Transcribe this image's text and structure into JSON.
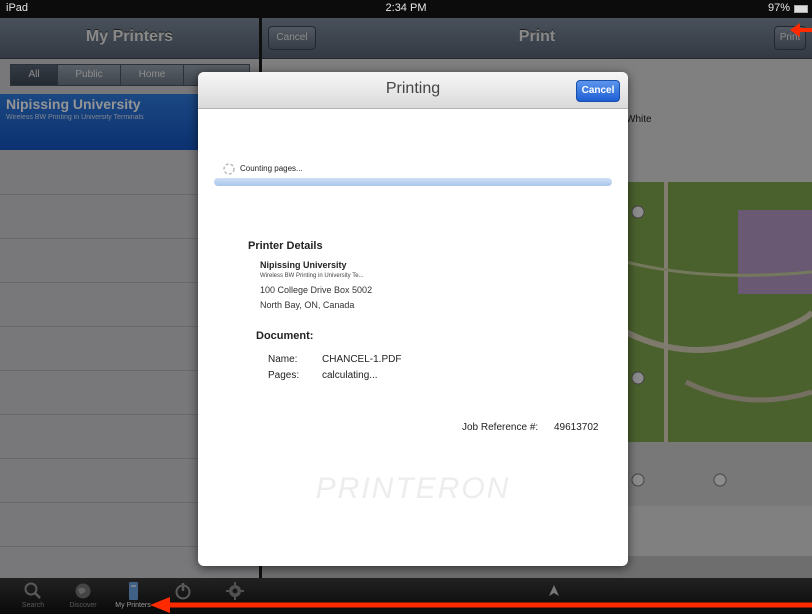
{
  "status_bar": {
    "device": "iPad",
    "time": "2:34 PM",
    "battery": "97%"
  },
  "left_panel": {
    "title": "My Printers",
    "segments": [
      "All",
      "Public",
      "Home"
    ],
    "selected_printer": {
      "name": "Nipissing University",
      "description": "Wireless BW Printing in University Terminals"
    }
  },
  "right_panel": {
    "title": "Print",
    "cancel_label": "Cancel",
    "print_label": "Print",
    "partial_label": "White"
  },
  "tab_bar": {
    "tabs": [
      {
        "label": "Search",
        "icon": "search-icon"
      },
      {
        "label": "Discover",
        "icon": "globe-icon"
      },
      {
        "label": "My Printers",
        "icon": "printer-icon"
      },
      {
        "label": "",
        "icon": "power-icon"
      },
      {
        "label": "",
        "icon": "gear-icon"
      }
    ]
  },
  "dialog": {
    "title": "Printing",
    "cancel_label": "Cancel",
    "status": "Counting pages...",
    "printer_details_heading": "Printer Details",
    "printer_name": "Nipissing University",
    "printer_description": "Wireless BW Printing in University Te...",
    "address_line1": "100 College Drive Box 5002",
    "address_line2": "North Bay, ON, Canada",
    "document_heading": "Document:",
    "name_label": "Name:",
    "name_value": "CHANCEL-1.PDF",
    "pages_label": "Pages:",
    "pages_value": "calculating...",
    "job_reference_label": "Job Reference #:",
    "job_reference_value": "49613702",
    "watermark": "PRINTERON"
  },
  "colors": {
    "accent": "#1d5fd4",
    "selection": "#1556c2",
    "annotation_arrow": "#ff2a00"
  }
}
